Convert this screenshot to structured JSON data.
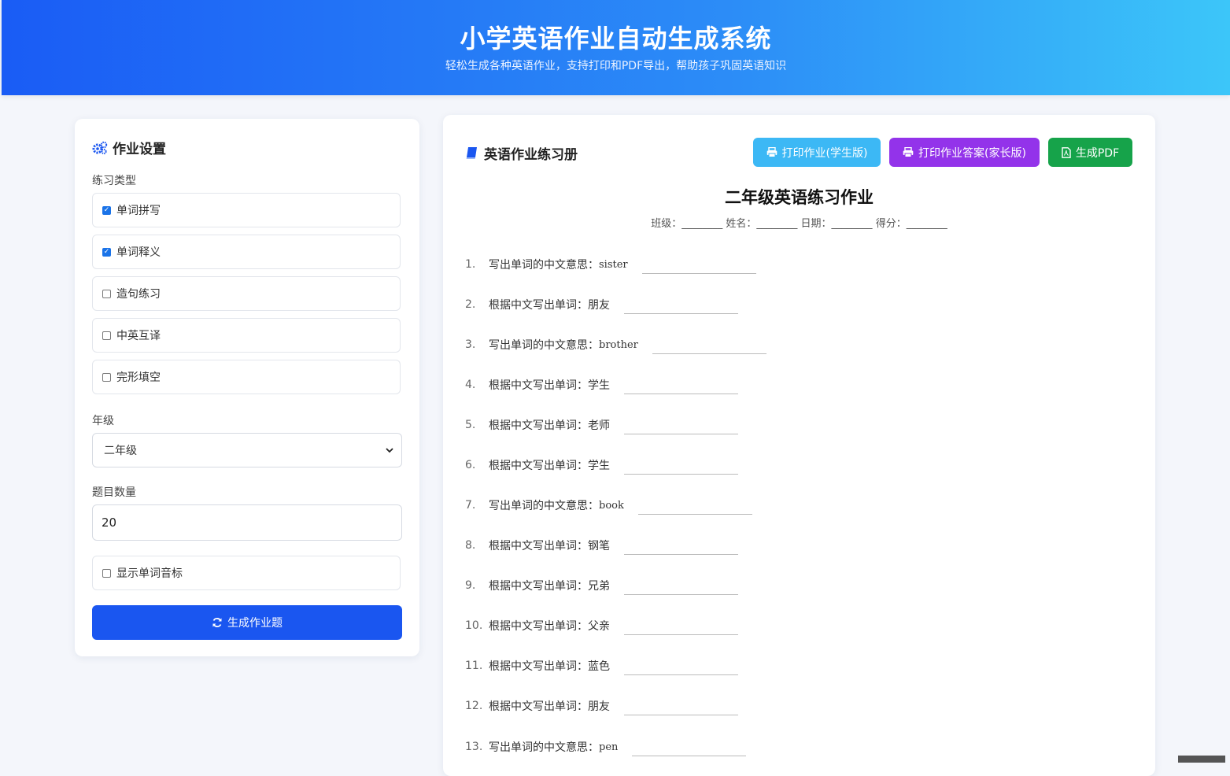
{
  "header": {
    "title": "小学英语作业自动生成系统",
    "subtitle": "轻松生成各种英语作业，支持打印和PDF导出，帮助孩子巩固英语知识"
  },
  "settings": {
    "title": "作业设置",
    "exercise_type_label": "练习类型",
    "exercise_types": [
      {
        "label": "单词拼写",
        "checked": true
      },
      {
        "label": "单词释义",
        "checked": true
      },
      {
        "label": "造句练习",
        "checked": false
      },
      {
        "label": "中英互译",
        "checked": false
      },
      {
        "label": "完形填空",
        "checked": false
      }
    ],
    "grade_label": "年级",
    "grade_value": "二年级",
    "count_label": "题目数量",
    "count_value": "20",
    "phonetic_label": "显示单词音标",
    "phonetic_checked": false,
    "generate_button": "生成作业题"
  },
  "worksheet": {
    "title": "英语作业练习册",
    "print_student": "打印作业(学生版)",
    "print_answer": "打印作业答案(家长版)",
    "export_pdf": "生成PDF",
    "sheet_title": "二年级英语练习作业",
    "meta": "班级：________ 姓名：________ 日期：________ 得分：________",
    "questions": [
      {
        "num": "1.",
        "prompt": "写出单词的中文意思：",
        "word": "sister",
        "en": true
      },
      {
        "num": "2.",
        "prompt": "根据中文写出单词：",
        "word": "朋友",
        "en": false
      },
      {
        "num": "3.",
        "prompt": "写出单词的中文意思：",
        "word": "brother",
        "en": true
      },
      {
        "num": "4.",
        "prompt": "根据中文写出单词：",
        "word": "学生",
        "en": false
      },
      {
        "num": "5.",
        "prompt": "根据中文写出单词：",
        "word": "老师",
        "en": false
      },
      {
        "num": "6.",
        "prompt": "根据中文写出单词：",
        "word": "学生",
        "en": false
      },
      {
        "num": "7.",
        "prompt": "写出单词的中文意思：",
        "word": "book",
        "en": true
      },
      {
        "num": "8.",
        "prompt": "根据中文写出单词：",
        "word": "钢笔",
        "en": false
      },
      {
        "num": "9.",
        "prompt": "根据中文写出单词：",
        "word": "兄弟",
        "en": false
      },
      {
        "num": "10.",
        "prompt": "根据中文写出单词：",
        "word": "父亲",
        "en": false
      },
      {
        "num": "11.",
        "prompt": "根据中文写出单词：",
        "word": "蓝色",
        "en": false
      },
      {
        "num": "12.",
        "prompt": "根据中文写出单词：",
        "word": "朋友",
        "en": false
      },
      {
        "num": "13.",
        "prompt": "写出单词的中文意思：",
        "word": "pen",
        "en": true
      }
    ]
  },
  "colors": {
    "primary": "#1a56f0",
    "student_btn": "#3cb8f5",
    "answer_btn": "#9333ea",
    "pdf_btn": "#16a34a"
  },
  "icons": {
    "settings": "gears-icon",
    "worksheet": "book-icon",
    "print": "print-icon",
    "pdf": "pdf-file-icon",
    "refresh": "refresh-icon"
  }
}
